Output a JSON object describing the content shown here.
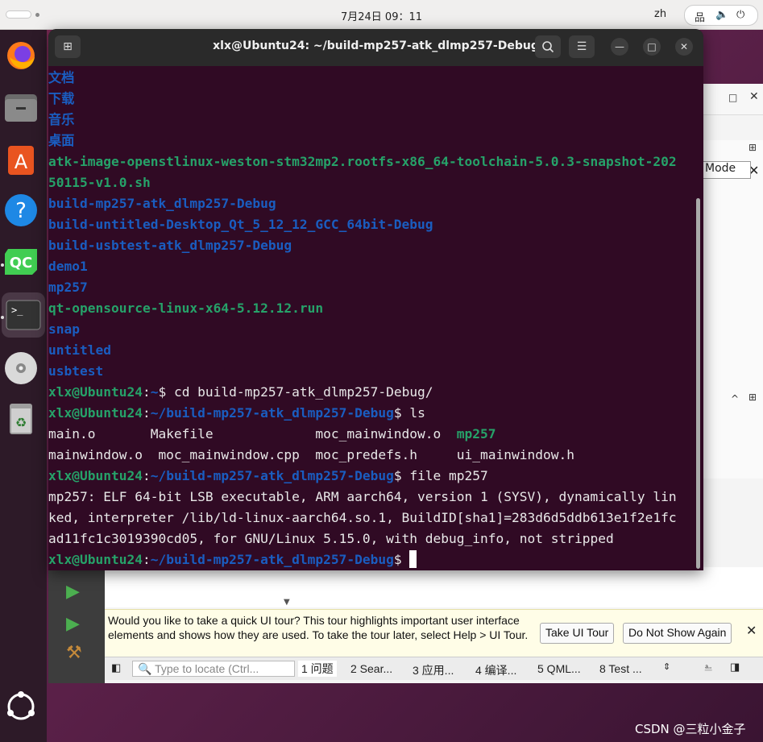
{
  "topbar": {
    "clock": "7月24日  09：11",
    "lang": "zh",
    "icons": [
      "network-icon",
      "volume-icon",
      "power-icon"
    ]
  },
  "dock": {
    "items": [
      "firefox",
      "files",
      "app-center",
      "help",
      "qt-creator",
      "terminal",
      "disc",
      "trash",
      "show-apps"
    ]
  },
  "terminal": {
    "title": "xlx@Ubuntu24: ~/build-mp257-atk_dlmp257-Debug",
    "lines": [
      [
        {
          "t": "文档",
          "c": "dir"
        }
      ],
      [
        {
          "t": "下载",
          "c": "dir"
        }
      ],
      [
        {
          "t": "音乐",
          "c": "dir"
        }
      ],
      [
        {
          "t": "桌面",
          "c": "dir"
        }
      ],
      [
        {
          "t": "atk-image-openstlinux-weston-stm32mp2.rootfs-x86_64-toolchain-5.0.3-snapshot-202",
          "c": "exe"
        }
      ],
      [
        {
          "t": "50115-v1.0.sh",
          "c": "exe"
        }
      ],
      [
        {
          "t": "build-mp257-atk_dlmp257-Debug",
          "c": "dir"
        }
      ],
      [
        {
          "t": "build-untitled-Desktop_Qt_5_12_12_GCC_64bit-Debug",
          "c": "dir"
        }
      ],
      [
        {
          "t": "build-usbtest-atk_dlmp257-Debug",
          "c": "dir"
        }
      ],
      [
        {
          "t": "demo1",
          "c": "dir"
        }
      ],
      [
        {
          "t": "mp257",
          "c": "dir"
        }
      ],
      [
        {
          "t": "qt-opensource-linux-x64-5.12.12.run",
          "c": "exe"
        }
      ],
      [
        {
          "t": "snap",
          "c": "dir"
        }
      ],
      [
        {
          "t": "untitled",
          "c": "dir"
        }
      ],
      [
        {
          "t": "usbtest",
          "c": "dir"
        }
      ],
      [
        {
          "t": "xlx@Ubuntu24",
          "c": "user"
        },
        {
          "t": ":",
          "c": ""
        },
        {
          "t": "~",
          "c": "path"
        },
        {
          "t": "$ cd build-mp257-atk_dlmp257-Debug/",
          "c": ""
        }
      ],
      [
        {
          "t": "xlx@Ubuntu24",
          "c": "user"
        },
        {
          "t": ":",
          "c": ""
        },
        {
          "t": "~/build-mp257-atk_dlmp257-Debug",
          "c": "path"
        },
        {
          "t": "$ ls",
          "c": ""
        }
      ],
      [
        {
          "t": "main.o       Makefile             moc_mainwindow.o  ",
          "c": ""
        },
        {
          "t": "mp257",
          "c": "exe"
        }
      ],
      [
        {
          "t": "mainwindow.o  moc_mainwindow.cpp  moc_predefs.h     ui_mainwindow.h",
          "c": ""
        }
      ],
      [
        {
          "t": "xlx@Ubuntu24",
          "c": "user"
        },
        {
          "t": ":",
          "c": ""
        },
        {
          "t": "~/build-mp257-atk_dlmp257-Debug",
          "c": "path"
        },
        {
          "t": "$ file mp257",
          "c": ""
        }
      ],
      [
        {
          "t": "mp257: ELF 64-bit LSB executable, ARM aarch64, version 1 (SYSV), dynamically lin",
          "c": ""
        }
      ],
      [
        {
          "t": "ked, interpreter /lib/ld-linux-aarch64.so.1, BuildID[sha1]=283d6d5ddb613e1f2e1fc",
          "c": ""
        }
      ],
      [
        {
          "t": "ad11fc1c3019390cd05, for GNU/Linux 5.15.0, with debug_info, not stripped",
          "c": ""
        }
      ],
      [
        {
          "t": "xlx@Ubuntu24",
          "c": "user"
        },
        {
          "t": ":",
          "c": ""
        },
        {
          "t": "~/build-mp257-atk_dlmp257-Debug",
          "c": "path"
        },
        {
          "t": "$ ",
          "c": ""
        }
      ]
    ]
  },
  "qt": {
    "mode_tab": "Mode",
    "tour_text": "Would you like to take a quick UI tour? This tour highlights important user interface elements and shows how they are used. To take the tour later, select Help > UI Tour.",
    "take_tour": "Take UI Tour",
    "do_not_show": "Do Not Show Again",
    "locate_placeholder": "Type to locate (Ctrl...",
    "tabs": [
      "1 问题",
      "2 Sear...",
      "3 应用...",
      "4 编译...",
      "5 QML...",
      "8 Test ..."
    ]
  },
  "watermark": "CSDN @三粒小金子"
}
